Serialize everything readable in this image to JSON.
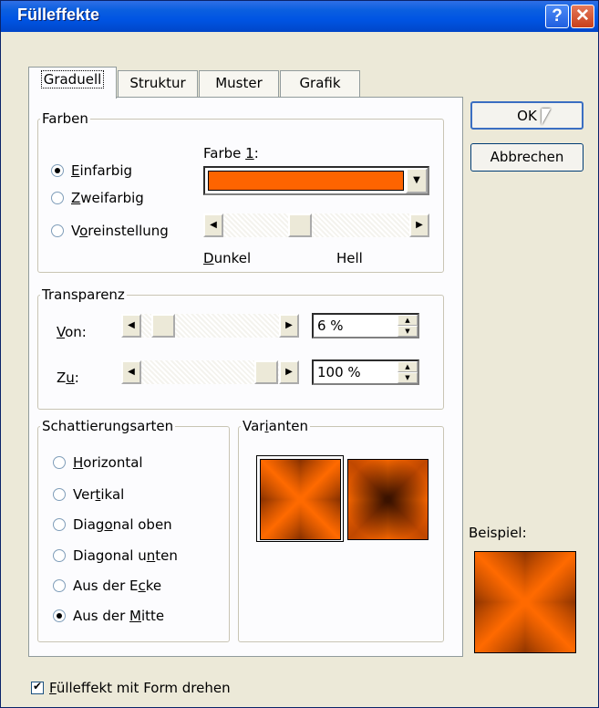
{
  "window": {
    "title": "Fülleffekte"
  },
  "titlebar": {
    "help_label": "?",
    "close_label": "✕"
  },
  "tabs": [
    {
      "label": "Graduell",
      "active": true
    },
    {
      "label": "Struktur",
      "active": false
    },
    {
      "label": "Muster",
      "active": false
    },
    {
      "label": "Grafik",
      "active": false
    }
  ],
  "farben": {
    "legend": "Farben",
    "options": [
      {
        "pre": "",
        "key": "E",
        "post": "infarbig",
        "selected": true
      },
      {
        "pre": "",
        "key": "Z",
        "post": "weifarbig",
        "selected": false
      },
      {
        "pre": "V",
        "key": "o",
        "post": "reinstellung",
        "selected": false
      }
    ],
    "farbe_label_pre": "Farbe ",
    "farbe_label_key": "1",
    "farbe_label_post": ":",
    "color": "#fe6400",
    "shade_value": 0.4,
    "dark_key": "D",
    "dark_rest": "unkel",
    "light": "Hell"
  },
  "transparenz": {
    "legend": "Transparenz",
    "from_key": "V",
    "from_rest": "on:",
    "from_value": "6 %",
    "to_pre": "Z",
    "to_key": "u",
    "to_post": ":",
    "to_value": "100 %"
  },
  "schattierung": {
    "legend": "Schattierungsarten",
    "options": [
      {
        "pre": "",
        "key": "H",
        "post": "orizontal",
        "selected": false
      },
      {
        "pre": "Ver",
        "key": "t",
        "post": "ikal",
        "selected": false
      },
      {
        "pre": "Diag",
        "key": "o",
        "post": "nal oben",
        "selected": false
      },
      {
        "pre": "Diagonal u",
        "key": "n",
        "post": "ten",
        "selected": false
      },
      {
        "pre": "Aus der E",
        "key": "c",
        "post": "ke",
        "selected": false
      },
      {
        "pre": "Aus der ",
        "key": "M",
        "post": "itte",
        "selected": true
      }
    ]
  },
  "varianten": {
    "legend_pre": "Var",
    "legend_key": "i",
    "legend_post": "anten"
  },
  "buttons": {
    "ok": "OK",
    "cancel": "Abbrechen"
  },
  "example_label": "Beispiel:",
  "rotate_checkbox": {
    "key": "F",
    "rest": "ülleffekt mit Form drehen",
    "checked": true
  },
  "colors": {
    "accent": "#fe6400",
    "dark": "#5a2200",
    "titlebar": "#0054e3"
  }
}
